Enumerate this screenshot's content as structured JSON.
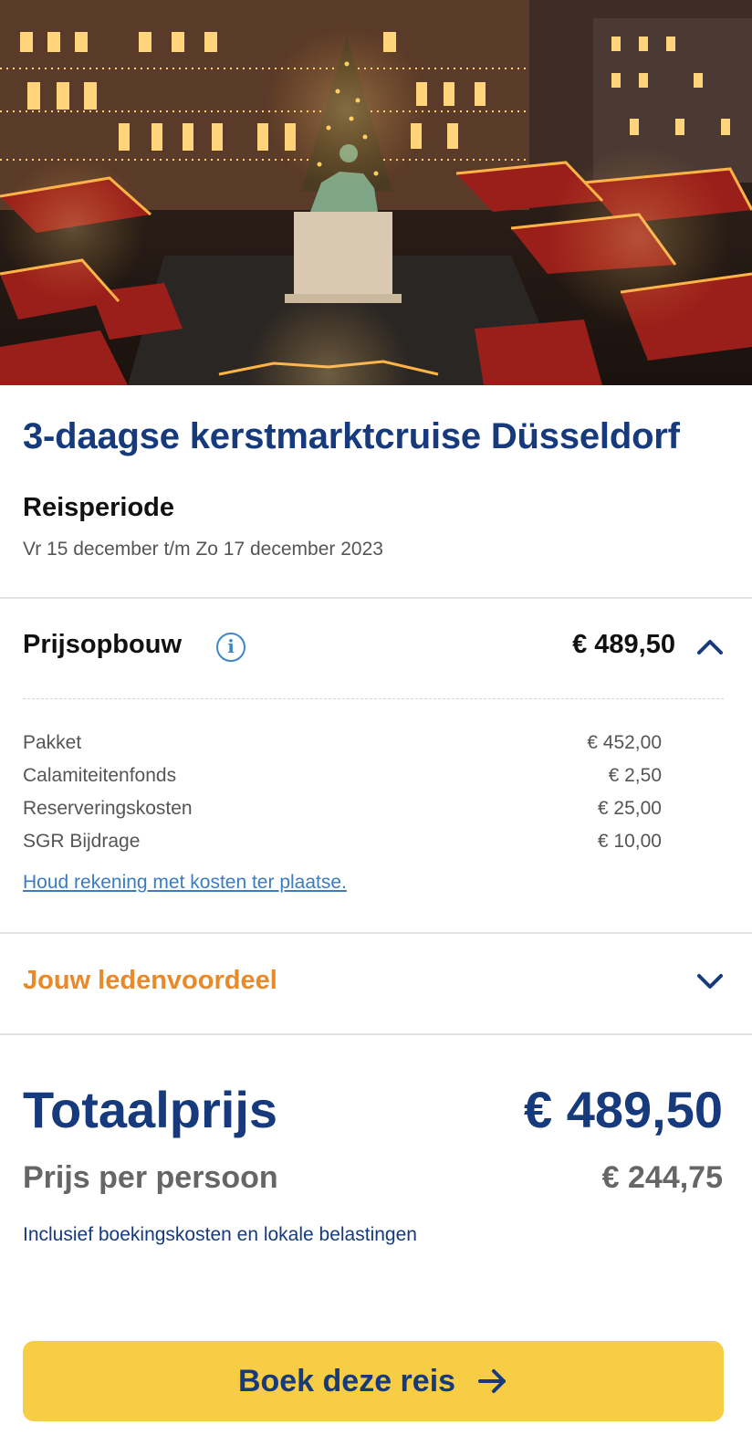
{
  "hero": {
    "image_alt": "Kerstmarkt Düsseldorf bij avond",
    "icon": "christmas-market-photo"
  },
  "trip": {
    "title": "3-daagse kerstmarktcruise Düsseldorf",
    "period_label": "Reisperiode",
    "period_value": "Vr 15 december t/m Zo 17 december 2023"
  },
  "price_breakdown": {
    "label": "Prijsopbouw",
    "info_icon": "info-icon",
    "total": "€ 489,50",
    "expanded": true,
    "items": [
      {
        "label": "Pakket",
        "value": "€ 452,00"
      },
      {
        "label": "Calamiteitenfonds",
        "value": "€ 2,50"
      },
      {
        "label": "Reserveringskosten",
        "value": "€ 25,00"
      },
      {
        "label": "SGR Bijdrage",
        "value": "€ 10,00"
      }
    ],
    "costs_link": "Houd rekening met kosten ter plaatse."
  },
  "member_benefit": {
    "label": "Jouw ledenvoordeel",
    "expanded": false
  },
  "totals": {
    "total_label": "Totaalprijs",
    "total_value": "€ 489,50",
    "per_person_label": "Prijs per persoon",
    "per_person_value": "€ 244,75",
    "inclusive_note": "Inclusief boekingskosten en lokale belastingen"
  },
  "cta": {
    "label": "Boek deze reis",
    "icon": "arrow-right-icon"
  },
  "colors": {
    "brand_blue": "#163a7c",
    "accent_orange": "#e8892a",
    "cta_yellow": "#f7cd46",
    "link_blue": "#3b7bc2"
  }
}
